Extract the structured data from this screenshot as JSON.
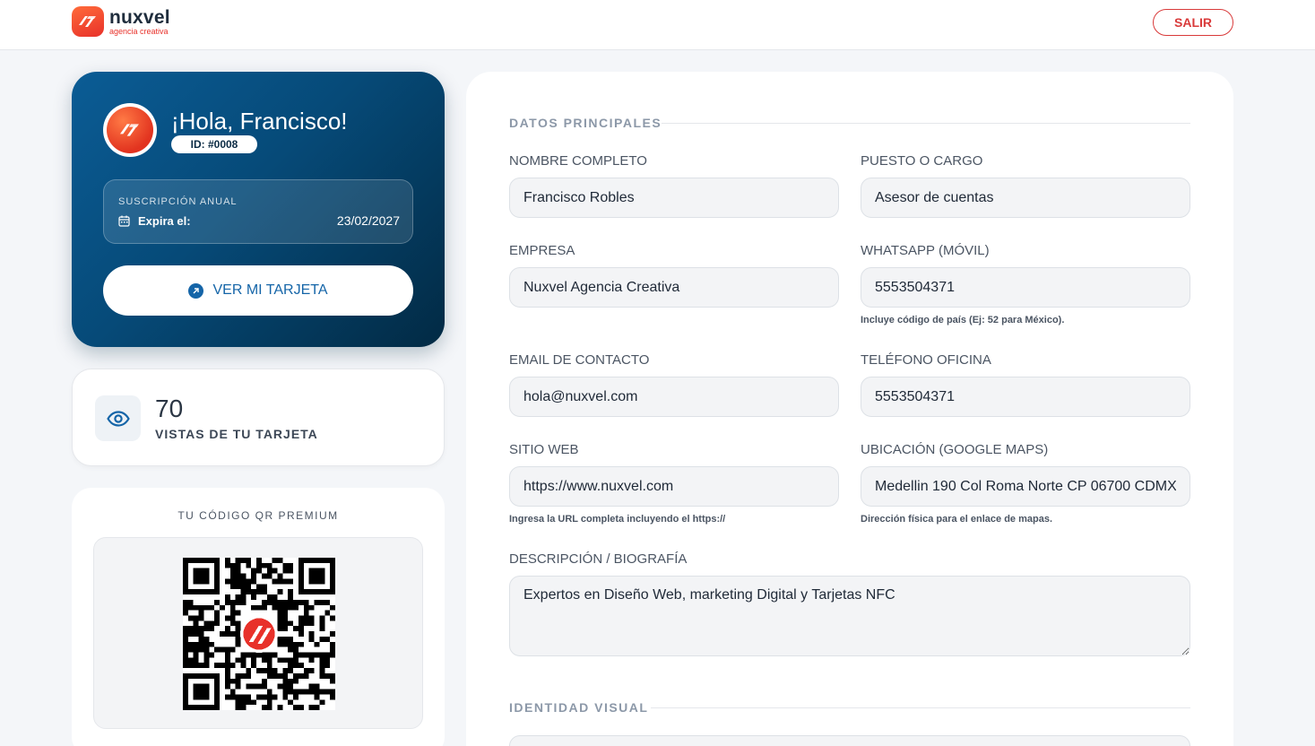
{
  "header": {
    "brand_name": "nuxvel",
    "brand_tagline": "agencia creativa",
    "logout_label": "SALIR"
  },
  "profile": {
    "greeting": "¡Hola, Francisco!",
    "id_badge": "ID: #0008",
    "subscription_label": "SUSCRIPCIÓN ANUAL",
    "expires_label": "Expira el:",
    "expires_date": "23/02/2027",
    "view_card_label": "VER MI TARJETA"
  },
  "stats": {
    "views_count": "70",
    "views_label": "VISTAS DE TU TARJETA"
  },
  "qr": {
    "title": "TU CÓDIGO QR PREMIUM"
  },
  "form": {
    "section_main": "DATOS PRINCIPALES",
    "section_visual": "IDENTIDAD VISUAL",
    "fields": {
      "full_name": {
        "label": "NOMBRE COMPLETO",
        "value": "Francisco Robles"
      },
      "position": {
        "label": "PUESTO O CARGO",
        "value": "Asesor de cuentas"
      },
      "company": {
        "label": "EMPRESA",
        "value": "Nuxvel Agencia Creativa"
      },
      "whatsapp": {
        "label": "WHATSAPP (MÓVIL)",
        "value": "5553504371",
        "hint": "Incluye código de país (Ej: 52 para México)."
      },
      "email": {
        "label": "EMAIL DE CONTACTO",
        "value": "hola@nuxvel.com"
      },
      "office_phone": {
        "label": "TELÉFONO OFICINA",
        "value": "5553504371"
      },
      "website": {
        "label": "SITIO WEB",
        "value": "https://www.nuxvel.com",
        "hint": "Ingresa la URL completa incluyendo el https://"
      },
      "location": {
        "label": "UBICACIÓN (GOOGLE MAPS)",
        "value": "Medellin 190 Col Roma Norte CP 06700 CDMX",
        "hint": "Dirección física para el enlace de mapas."
      },
      "description": {
        "label": "DESCRIPCIÓN / BIOGRAFÍA",
        "value": "Expertos en Diseño Web, marketing Digital y Tarjetas NFC"
      }
    }
  },
  "colors": {
    "accent_red": "#d93a3a",
    "brand_orange": "#e8312a",
    "hero_blue": "#0b5c95",
    "link_blue": "#1565a8"
  },
  "icons": {
    "logout": "none",
    "calendar": "calendar-icon",
    "view_card": "arrow-up-right-icon",
    "views": "eye-icon"
  }
}
